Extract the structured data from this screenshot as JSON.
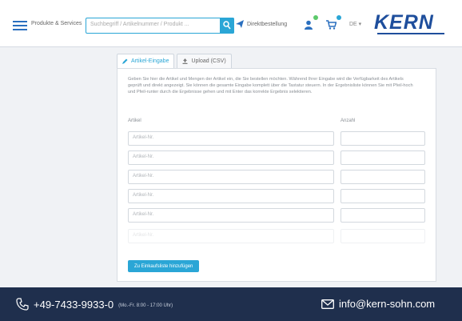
{
  "header": {
    "menu_label": "Produkte & Services",
    "search_placeholder": "Suchbegriff / Artikelnummer / Produkt ...",
    "direct_order_label": "Direktbestellung",
    "language": "DE ▾",
    "logo_text": "KERN"
  },
  "tabs": [
    {
      "label": "Artikel-Eingabe",
      "icon": "pencil-icon",
      "active": true
    },
    {
      "label": "Upload (CSV)",
      "icon": "upload-icon",
      "active": false
    }
  ],
  "form": {
    "info_text": "Geben Sie hier die Artikel und Mengen der Artikel ein, die Sie bestellen möchten. Während Ihrer Eingabe wird die Verfügbarkeit des Artikels geprüft und direkt angezeigt. Sie können die gesamte Eingabe komplett über die Tastatur steuern. In der Ergebnisliste können Sie mit Pfeil-hoch und Pfeil-runter durch die Ergebnisse gehen und mit Enter das korrekte Ergebnis selektieren.",
    "col_article": "Artikel",
    "col_qty": "Anzahl",
    "article_placeholder": "Artikel-Nr.",
    "add_button_label": "Zu Einkaufsliste hinzufügen"
  },
  "footer": {
    "phone": "+49-7433-9933-0",
    "hours": "(Mo.-Fr. 8:00 - 17:00 Uhr)",
    "email": "info@kern-sohn.com"
  },
  "colors": {
    "accent": "#2aa6d6",
    "brand": "#1e4e9c",
    "footer_bg": "#1f2f4d",
    "user_dot": "#5cc96b",
    "cart_dot": "#2aa6d6"
  }
}
